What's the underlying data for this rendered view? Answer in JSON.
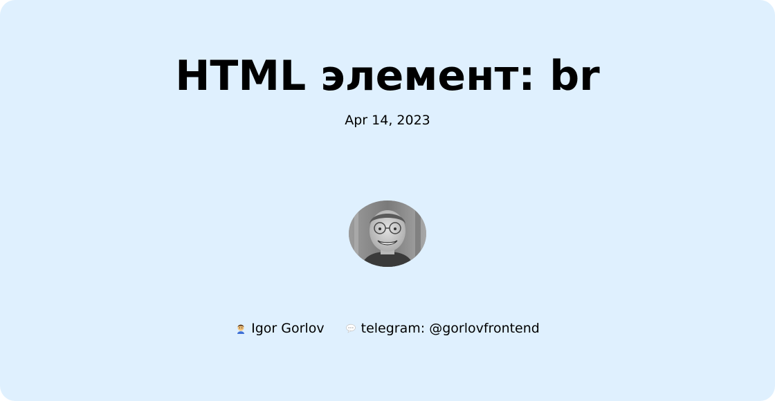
{
  "card": {
    "title": "HTML элемент: br",
    "date": "Apr 14, 2023"
  },
  "author": {
    "name": "Igor Gorlov",
    "name_icon": "person-emoji-icon",
    "contact": "telegram: @gorlovfrontend",
    "contact_icon": "speech-bubble-icon",
    "avatar": "author-avatar-photo"
  },
  "colors": {
    "background": "#dff0fe",
    "text": "#000000"
  }
}
